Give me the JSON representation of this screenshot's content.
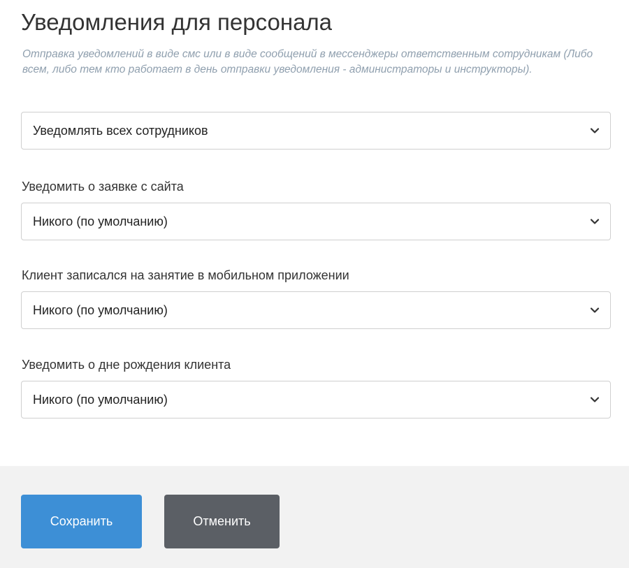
{
  "section": {
    "title": "Уведомления для персонала",
    "description": "Отправка уведомлений в виде смс или в виде сообщений в мессенджеры ответственным сотрудникам (Либо всем, либо тем кто работает в день отправки уведомления - администраторы и инструкторы)."
  },
  "recipients_select": {
    "value": "Уведомлять всех сотрудников"
  },
  "fields": [
    {
      "label": "Уведомить о заявке с сайта",
      "value": "Никого (по умолчанию)"
    },
    {
      "label": "Клиент записался на занятие в мобильном приложении",
      "value": "Никого (по умолчанию)"
    },
    {
      "label": "Уведомить о дне рождения клиента",
      "value": "Никого (по умолчанию)"
    }
  ],
  "actions": {
    "save_label": "Сохранить",
    "cancel_label": "Отменить"
  },
  "icons": {
    "select_arrow": "chevron-down-icon"
  },
  "colors": {
    "save_button": "#3d8fd6",
    "cancel_button": "#5b5f65",
    "description_text": "#8f9fae",
    "footer_background": "#f2f2f2"
  }
}
